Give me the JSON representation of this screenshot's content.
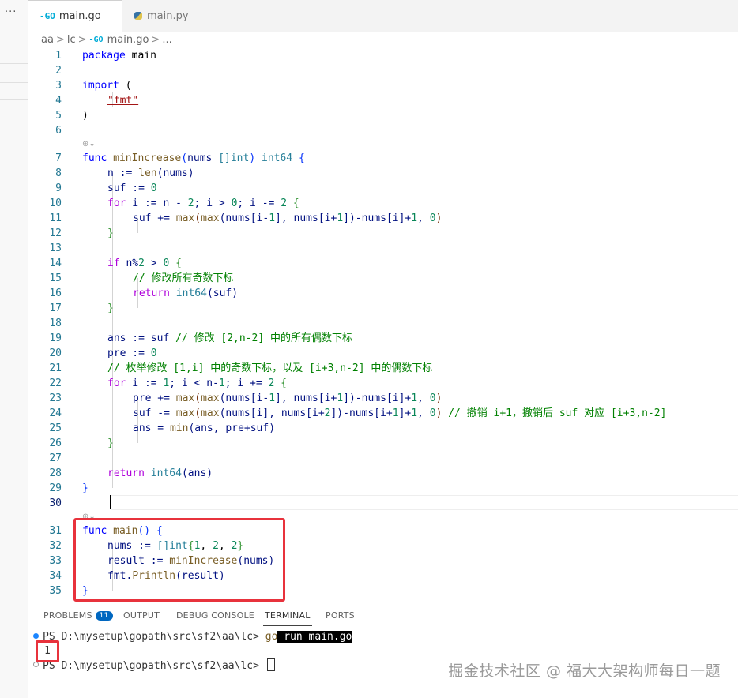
{
  "tabs": [
    {
      "label": "main.go",
      "icon": "go-file-icon",
      "active": true
    },
    {
      "label": "main.py",
      "icon": "python-file-icon",
      "active": false
    }
  ],
  "activity": {
    "more_label": "···"
  },
  "breadcrumb": [
    "aa",
    "lc",
    "main.go",
    "..."
  ],
  "go_logo_text": "-GO",
  "editor": {
    "current_line": 30,
    "code_lens_icon": "⊕⌄",
    "lines": [
      {
        "n": "1"
      },
      {
        "n": "2"
      },
      {
        "n": "3"
      },
      {
        "n": "4"
      },
      {
        "n": "5"
      },
      {
        "n": "6"
      },
      {
        "n": "7"
      },
      {
        "n": "8"
      },
      {
        "n": "9"
      },
      {
        "n": "10"
      },
      {
        "n": "11"
      },
      {
        "n": "12"
      },
      {
        "n": "13"
      },
      {
        "n": "14"
      },
      {
        "n": "15"
      },
      {
        "n": "16"
      },
      {
        "n": "17"
      },
      {
        "n": "18"
      },
      {
        "n": "19"
      },
      {
        "n": "20"
      },
      {
        "n": "21"
      },
      {
        "n": "22"
      },
      {
        "n": "23"
      },
      {
        "n": "24"
      },
      {
        "n": "25"
      },
      {
        "n": "26"
      },
      {
        "n": "27"
      },
      {
        "n": "28"
      },
      {
        "n": "29"
      },
      {
        "n": "30"
      },
      {
        "n": "31"
      },
      {
        "n": "32"
      },
      {
        "n": "33"
      },
      {
        "n": "34"
      },
      {
        "n": "35"
      }
    ],
    "code": {
      "l1_kw": "package",
      "l1_rest": " main",
      "l3_kw": "import",
      "l3_rest": " (",
      "l4_str": "\"fmt\"",
      "l5": ")",
      "l7_kw": "func",
      "l7_fn": "minIncrease",
      "l7_p1": "(",
      "l7_arg": "nums ",
      "l7_t1": "[]int",
      "l7_p2": ") ",
      "l7_t2": "int64",
      "l7_end": " {",
      "l8_a": "n := ",
      "l8_fn": "len",
      "l8_b": "(nums)",
      "l9_a": "suf := ",
      "l9_n": "0",
      "l10_kw": "for",
      "l10_a": " i := n - ",
      "l10_n1": "2",
      "l10_b": "; i > ",
      "l10_n2": "0",
      "l10_c": "; i -= ",
      "l10_n3": "2",
      "l10_d": " {",
      "l11_a": "suf += ",
      "l11_fn1": "max",
      "l11_b": "(",
      "l11_fn2": "max",
      "l11_c": "(nums[i-",
      "l11_n1": "1",
      "l11_d": "], nums[i+",
      "l11_n2": "1",
      "l11_e": "])-nums[i]+",
      "l11_n3": "1",
      "l11_f": ", ",
      "l11_n4": "0",
      "l11_g": ")",
      "l12": "}",
      "l14_kw": "if",
      "l14_a": " n%",
      "l14_n1": "2",
      "l14_b": " > ",
      "l14_n2": "0",
      "l14_c": " {",
      "l15_cm": "// 修改所有奇数下标",
      "l16_kw": "return",
      "l16_a": " ",
      "l16_fn": "int64",
      "l16_b": "(suf)",
      "l17": "}",
      "l19_a": "ans := suf ",
      "l19_cm": "// 修改 [2,n-2] 中的所有偶数下标",
      "l20_a": "pre := ",
      "l20_n": "0",
      "l21_cm": "// 枚举修改 [1,i] 中的奇数下标，以及 [i+3,n-2] 中的偶数下标",
      "l22_kw": "for",
      "l22_a": " i := ",
      "l22_n1": "1",
      "l22_b": "; i < n-",
      "l22_n2": "1",
      "l22_c": "; i += ",
      "l22_n3": "2",
      "l22_d": " {",
      "l23_a": "pre += ",
      "l23_fn1": "max",
      "l23_b": "(",
      "l23_fn2": "max",
      "l23_c": "(nums[i-",
      "l23_n1": "1",
      "l23_d": "], nums[i+",
      "l23_n2": "1",
      "l23_e": "])-nums[i]+",
      "l23_n3": "1",
      "l23_f": ", ",
      "l23_n4": "0",
      "l23_g": ")",
      "l24_a": "suf -= ",
      "l24_fn1": "max",
      "l24_b": "(",
      "l24_fn2": "max",
      "l24_c": "(nums[i], nums[i+",
      "l24_n1": "2",
      "l24_d": "])-nums[i+",
      "l24_n2": "1",
      "l24_e": "]+",
      "l24_n3": "1",
      "l24_f": ", ",
      "l24_n4": "0",
      "l24_g": ") ",
      "l24_cm": "// 撤销 i+1，撤销后 suf 对应 [i+3,n-2]",
      "l25_a": "ans = ",
      "l25_fn": "min",
      "l25_b": "(ans, pre+suf)",
      "l26": "}",
      "l28_kw": "return",
      "l28_a": " ",
      "l28_fn": "int64",
      "l28_b": "(ans)",
      "l29": "}",
      "l31_kw": "func",
      "l31_a": " ",
      "l31_fn": "main",
      "l31_b": "() {",
      "l32_a": "nums := ",
      "l32_t": "[]int",
      "l32_b": "{",
      "l32_n1": "1",
      "l32_c": ", ",
      "l32_n2": "2",
      "l32_d": ", ",
      "l32_n3": "2",
      "l32_e": "}",
      "l33_a": "result := ",
      "l33_fn": "minIncrease",
      "l33_b": "(nums)",
      "l34_a": "fmt.",
      "l34_fn": "Println",
      "l34_b": "(result)",
      "l35": "}"
    }
  },
  "panel": {
    "tabs": [
      {
        "label": "PROBLEMS",
        "badge": "11"
      },
      {
        "label": "OUTPUT"
      },
      {
        "label": "DEBUG CONSOLE"
      },
      {
        "label": "TERMINAL"
      },
      {
        "label": "PORTS"
      }
    ],
    "active_tab": "TERMINAL"
  },
  "terminal": {
    "prompt1": "PS D:\\mysetup\\gopath\\src\\sf2\\aa\\lc> ",
    "cmd_go": "go",
    "cmd_rest": " run main.go",
    "output": "1",
    "prompt2": "PS D:\\mysetup\\gopath\\src\\sf2\\aa\\lc> "
  },
  "watermark": "掘金技术社区 @ 福大大架构师每日一题",
  "colors": {
    "keyword": "#0000ff",
    "control": "#af00db",
    "function": "#795e26",
    "type": "#267f99",
    "number": "#098658",
    "comment": "#008000",
    "annotation_red": "#e8323c"
  }
}
